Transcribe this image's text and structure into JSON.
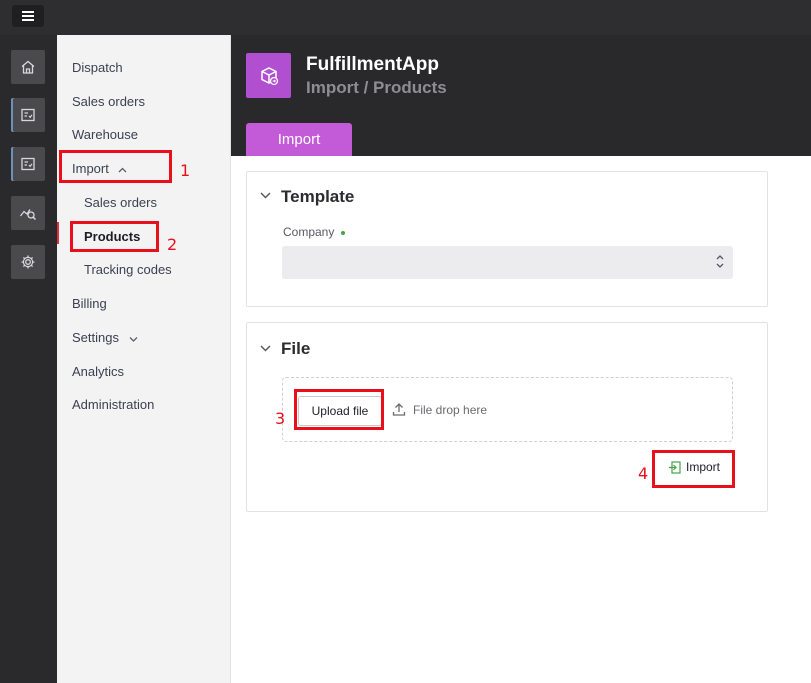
{
  "topbar": {
    "menu_icon": "hamburger-icon"
  },
  "rail": {
    "items": [
      {
        "icon": "home-icon"
      },
      {
        "icon": "checklist-icon"
      },
      {
        "icon": "checklist-icon"
      },
      {
        "icon": "analytics-icon"
      },
      {
        "icon": "gear-icon"
      }
    ]
  },
  "nav": {
    "items": [
      {
        "label": "Dispatch"
      },
      {
        "label": "Sales orders"
      },
      {
        "label": "Warehouse"
      },
      {
        "label": "Import"
      },
      {
        "label": "Sales orders"
      },
      {
        "label": "Products"
      },
      {
        "label": "Tracking codes"
      },
      {
        "label": "Billing"
      },
      {
        "label": "Settings"
      },
      {
        "label": "Analytics"
      },
      {
        "label": "Administration"
      }
    ]
  },
  "header": {
    "title": "FulfillmentApp",
    "breadcrumb": "Import / Products",
    "tab": "Import"
  },
  "template_panel": {
    "title": "Template",
    "company_label": "Company",
    "company_value": ""
  },
  "file_panel": {
    "title": "File",
    "upload_label": "Upload file",
    "drop_text": "File drop here",
    "import_label": "Import"
  },
  "annotations": [
    "1",
    "2",
    "3",
    "4"
  ],
  "colors": {
    "accent": "#c35ad8",
    "annotation": "#e8101c",
    "required": "#47a34a"
  }
}
